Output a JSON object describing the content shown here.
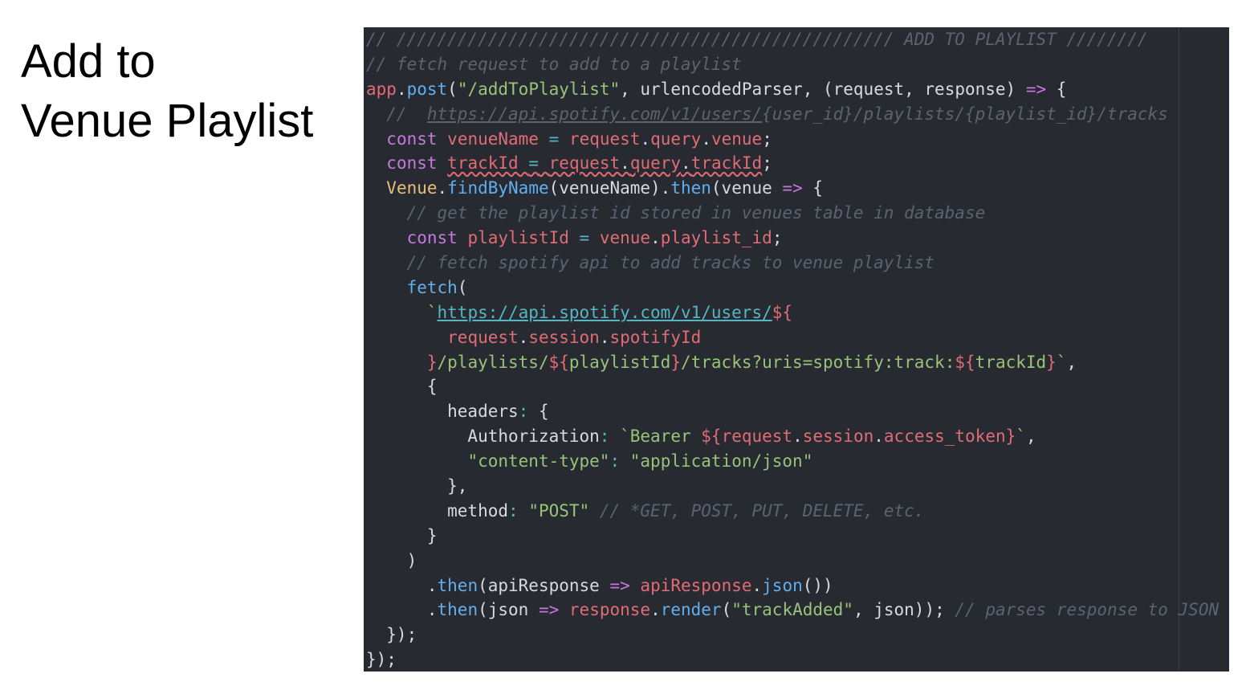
{
  "slide": {
    "title_line1": "Add to",
    "title_line2": "Venue Playlist"
  },
  "code": {
    "lines": [
      [
        [
          "c",
          "// ///////////////////////////////////////////////// ADD TO PLAYLIST ////////"
        ]
      ],
      [
        [
          "c",
          "// fetch request to add to a playlist"
        ]
      ],
      [
        [
          "v",
          "app"
        ],
        [
          "p",
          "."
        ],
        [
          "f",
          "post"
        ],
        [
          "p",
          "("
        ],
        [
          "s",
          "\"/addToPlaylist\""
        ],
        [
          "p",
          ", urlencodedParser, (request, response) "
        ],
        [
          "kw",
          "=>"
        ],
        [
          "p",
          " {"
        ]
      ],
      [
        [
          "c",
          "  //  "
        ],
        [
          "cu",
          "https://api.spotify.com/v1/users/"
        ],
        [
          "c",
          "{user_id}/playlists/{playlist_id}/tracks"
        ]
      ],
      [
        [
          "p",
          "  "
        ],
        [
          "kw",
          "const"
        ],
        [
          "p",
          " "
        ],
        [
          "v",
          "venueName"
        ],
        [
          "p",
          " "
        ],
        [
          "o",
          "="
        ],
        [
          "p",
          " "
        ],
        [
          "v",
          "request"
        ],
        [
          "p",
          "."
        ],
        [
          "v",
          "query"
        ],
        [
          "p",
          "."
        ],
        [
          "v",
          "venue"
        ],
        [
          "p",
          ";"
        ]
      ],
      [
        [
          "p",
          "  "
        ],
        [
          "kw",
          "const"
        ],
        [
          "p",
          " "
        ],
        [
          "v sq",
          "trackId"
        ],
        [
          "p sq",
          " "
        ],
        [
          "o sq",
          "="
        ],
        [
          "p sq",
          " "
        ],
        [
          "v sq",
          "request"
        ],
        [
          "p sq",
          "."
        ],
        [
          "v sq",
          "query"
        ],
        [
          "p sq",
          "."
        ],
        [
          "v sq",
          "trackId"
        ],
        [
          "p",
          ";"
        ]
      ],
      [
        [
          "p",
          "  "
        ],
        [
          "t",
          "Venue"
        ],
        [
          "p",
          "."
        ],
        [
          "f",
          "findByName"
        ],
        [
          "p",
          "(venueName)."
        ],
        [
          "f",
          "then"
        ],
        [
          "p",
          "(venue "
        ],
        [
          "kw",
          "=>"
        ],
        [
          "p",
          " {"
        ]
      ],
      [
        [
          "c",
          "    // get the playlist id stored in venues table in database"
        ]
      ],
      [
        [
          "p",
          "    "
        ],
        [
          "kw",
          "const"
        ],
        [
          "p",
          " "
        ],
        [
          "v",
          "playlistId"
        ],
        [
          "p",
          " "
        ],
        [
          "o",
          "="
        ],
        [
          "p",
          " "
        ],
        [
          "v",
          "venue"
        ],
        [
          "p",
          "."
        ],
        [
          "v",
          "playlist_id"
        ],
        [
          "p",
          ";"
        ]
      ],
      [
        [
          "c",
          "    // fetch spotify api to add tracks to venue playlist"
        ]
      ],
      [
        [
          "p",
          "    "
        ],
        [
          "f",
          "fetch"
        ],
        [
          "p",
          "("
        ]
      ],
      [
        [
          "p",
          "      "
        ],
        [
          "s",
          "`"
        ],
        [
          "link",
          "https://api.spotify.com/v1/users/"
        ],
        [
          "v",
          "${"
        ]
      ],
      [
        [
          "p",
          "        "
        ],
        [
          "v",
          "request"
        ],
        [
          "p",
          "."
        ],
        [
          "v",
          "session"
        ],
        [
          "p",
          "."
        ],
        [
          "v",
          "spotifyId"
        ]
      ],
      [
        [
          "p",
          "      "
        ],
        [
          "v",
          "}"
        ],
        [
          "s",
          "/playlists/"
        ],
        [
          "v",
          "${"
        ],
        [
          "s",
          "playlistId"
        ],
        [
          "v",
          "}"
        ],
        [
          "s",
          "/tracks?uris=spotify:track:"
        ],
        [
          "v",
          "${"
        ],
        [
          "s",
          "trackId"
        ],
        [
          "v",
          "}"
        ],
        [
          "s",
          "`"
        ],
        [
          "p",
          ","
        ]
      ],
      [
        [
          "p",
          "      {"
        ]
      ],
      [
        [
          "p",
          "        headers"
        ],
        [
          "o",
          ":"
        ],
        [
          "p",
          " {"
        ]
      ],
      [
        [
          "p",
          "          Authorization"
        ],
        [
          "o",
          ":"
        ],
        [
          "p",
          " "
        ],
        [
          "s",
          "`Bearer "
        ],
        [
          "v",
          "${"
        ],
        [
          "v",
          "request"
        ],
        [
          "p",
          "."
        ],
        [
          "v",
          "session"
        ],
        [
          "p",
          "."
        ],
        [
          "v",
          "access_token"
        ],
        [
          "v",
          "}"
        ],
        [
          "s",
          "`"
        ],
        [
          "p",
          ","
        ]
      ],
      [
        [
          "p",
          "          "
        ],
        [
          "s",
          "\"content-type\""
        ],
        [
          "o",
          ":"
        ],
        [
          "p",
          " "
        ],
        [
          "s",
          "\"application/json\""
        ]
      ],
      [
        [
          "p",
          "        },"
        ]
      ],
      [
        [
          "p",
          "        method"
        ],
        [
          "o",
          ":"
        ],
        [
          "p",
          " "
        ],
        [
          "s",
          "\"POST\""
        ],
        [
          "p",
          " "
        ],
        [
          "c",
          "// *GET, POST, PUT, DELETE, etc."
        ]
      ],
      [
        [
          "p",
          "      }"
        ]
      ],
      [
        [
          "p",
          "    )"
        ]
      ],
      [
        [
          "p",
          "      ."
        ],
        [
          "f",
          "then"
        ],
        [
          "p",
          "(apiResponse "
        ],
        [
          "kw",
          "=>"
        ],
        [
          "p",
          " "
        ],
        [
          "v",
          "apiResponse"
        ],
        [
          "p",
          "."
        ],
        [
          "f",
          "json"
        ],
        [
          "p",
          "())"
        ]
      ],
      [
        [
          "p",
          "      ."
        ],
        [
          "f",
          "then"
        ],
        [
          "p",
          "(json "
        ],
        [
          "kw",
          "=>"
        ],
        [
          "p",
          " "
        ],
        [
          "v",
          "response"
        ],
        [
          "p",
          "."
        ],
        [
          "f",
          "render"
        ],
        [
          "p",
          "("
        ],
        [
          "s",
          "\"trackAdded\""
        ],
        [
          "p",
          ", json)); "
        ],
        [
          "c",
          "// parses response to JSON"
        ]
      ],
      [
        [
          "p",
          "  });"
        ]
      ],
      [
        [
          "p",
          "});"
        ]
      ]
    ]
  }
}
